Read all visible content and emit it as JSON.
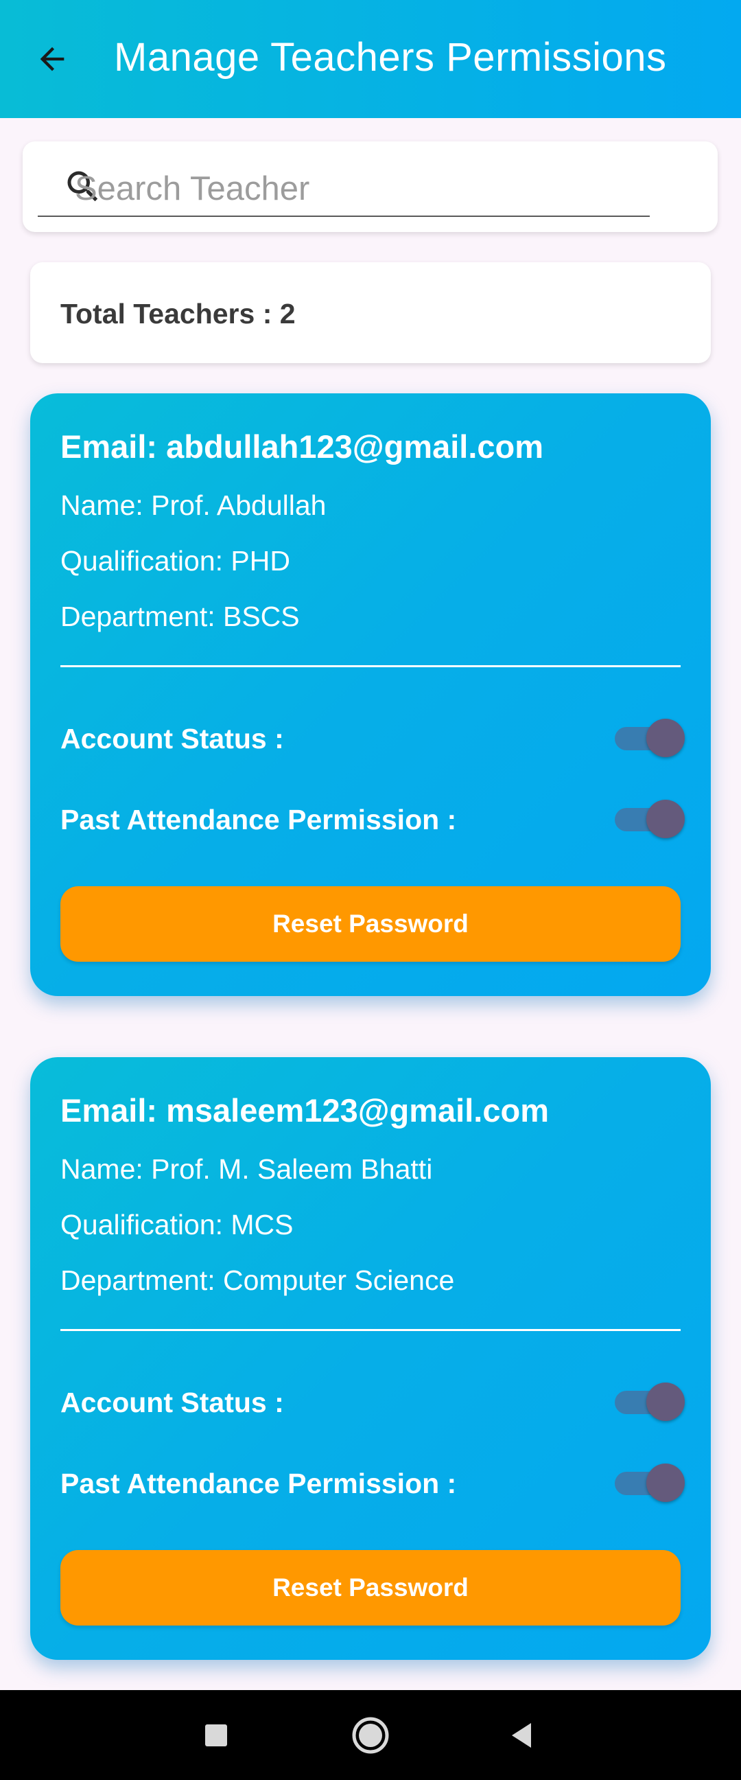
{
  "app_bar": {
    "title": "Manage Teachers Permissions",
    "back_icon": "arrow-back-icon",
    "background": "#03a9f0"
  },
  "search": {
    "placeholder": "Search Teacher",
    "value": "",
    "icon": "search-icon"
  },
  "summary": {
    "total_label": "Total Teachers : 2"
  },
  "teachers": [
    {
      "email": "Email: abdullah123@gmail.com",
      "name": "Name: Prof. Abdullah",
      "qualification": "Qualification: PHD",
      "department": "Department: BSCS",
      "account_status_label": "Account Status :",
      "account_status_on": true,
      "past_attendance_label": "Past Attendance Permission :",
      "past_attendance_on": true,
      "reset_label": "Reset Password"
    },
    {
      "email": "Email: msaleem123@gmail.com",
      "name": "Name: Prof. M. Saleem Bhatti",
      "qualification": "Qualification: MCS",
      "department": "Department: Computer Science",
      "account_status_label": "Account Status :",
      "account_status_on": true,
      "past_attendance_label": "Past Attendance Permission :",
      "past_attendance_on": true,
      "reset_label": "Reset Password"
    }
  ],
  "colors": {
    "accent": "#08bcd9",
    "button": "#ff9800",
    "toggle_thumb": "#645a7c"
  },
  "nav": {
    "recents_icon": "square-recents-icon",
    "home_icon": "circle-home-icon",
    "back_icon": "triangle-back-icon"
  }
}
